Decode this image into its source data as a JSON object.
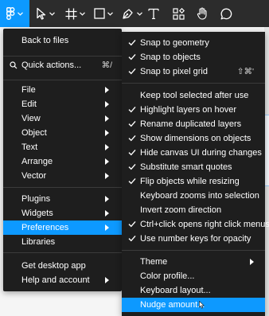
{
  "toolbar": {
    "tools": [
      {
        "icon": "figma-main-menu-icon",
        "active": true
      },
      {
        "icon": "move-tool-icon"
      },
      {
        "icon": "frame-tool-icon"
      },
      {
        "icon": "rectangle-tool-icon"
      },
      {
        "icon": "pen-tool-icon"
      },
      {
        "icon": "text-tool-icon"
      },
      {
        "icon": "resources-icon"
      },
      {
        "icon": "hand-tool-icon"
      },
      {
        "icon": "comment-tool-icon"
      }
    ]
  },
  "menu": {
    "back_to_files": "Back to files",
    "quick_actions": {
      "label": "Quick actions...",
      "shortcut": "⌘/"
    },
    "file": "File",
    "edit": "Edit",
    "view": "View",
    "object": "Object",
    "text": "Text",
    "arrange": "Arrange",
    "vector": "Vector",
    "plugins": "Plugins",
    "widgets": "Widgets",
    "preferences": "Preferences",
    "libraries": "Libraries",
    "get_desktop_app": "Get desktop app",
    "help_and_account": "Help and account"
  },
  "submenu": {
    "snap_to_geometry": "Snap to geometry",
    "snap_to_objects": "Snap to objects",
    "snap_to_pixel_grid": {
      "label": "Snap to pixel grid",
      "shortcut": "⇧⌘'"
    },
    "keep_tool_selected": "Keep tool selected after use",
    "highlight_layers": "Highlight layers on hover",
    "rename_duplicated": "Rename duplicated layers",
    "show_dimensions": "Show dimensions on objects",
    "hide_canvas_ui": "Hide canvas UI during changes",
    "substitute_quotes": "Substitute smart quotes",
    "flip_objects": "Flip objects while resizing",
    "keyboard_zooms": "Keyboard zooms into selection",
    "invert_zoom": "Invert zoom direction",
    "ctrl_click": "Ctrl+click opens right click menus",
    "number_keys_opacity": "Use number keys for opacity",
    "theme": "Theme",
    "color_profile": "Color profile...",
    "keyboard_layout": "Keyboard layout...",
    "nudge_amount": "Nudge amount..."
  },
  "colors": {
    "accent": "#0d99ff",
    "menu_bg": "#1e1e1e",
    "toolbar_bg": "#2c2c2c"
  }
}
